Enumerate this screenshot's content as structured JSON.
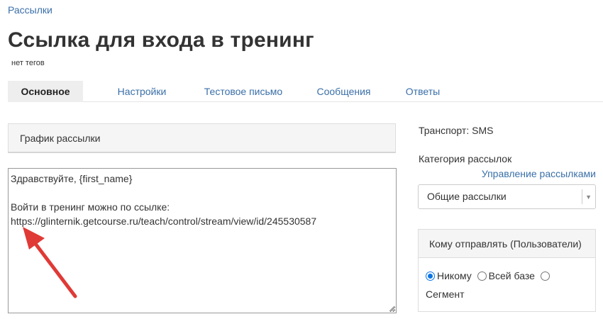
{
  "breadcrumb": "Рассылки",
  "title": "Ссылка для входа в тренинг",
  "tags": "нет тегов",
  "tabs": [
    {
      "label": "Основное",
      "active": true
    },
    {
      "label": "Настройки",
      "active": false
    },
    {
      "label": "Тестовое письмо",
      "active": false
    },
    {
      "label": "Сообщения",
      "active": false
    },
    {
      "label": "Ответы",
      "active": false
    }
  ],
  "schedule_panel": {
    "title": "График рассылки"
  },
  "message": {
    "line1": "Здравствуйте, {first_name}",
    "line2": "",
    "line3": "Войти в тренинг можно по ссылке:",
    "line4": "https://glinternik.getcourse.ru/teach/control/stream/view/id/245530587"
  },
  "sidebar": {
    "transport": "Транспорт: SMS",
    "category_label": "Категория рассылок",
    "manage_link": "Управление рассылками",
    "category_value": "Общие рассылки",
    "who": {
      "title": "Кому отправлять (Пользователи)",
      "options": [
        {
          "label": "Никому",
          "checked": true
        },
        {
          "label": "Всей базе",
          "checked": false
        },
        {
          "label": "Сегмент",
          "checked": false
        }
      ]
    }
  },
  "colors": {
    "link": "#3a6fa8",
    "arrow": "#e03a36",
    "radio": "#0b74e5"
  }
}
